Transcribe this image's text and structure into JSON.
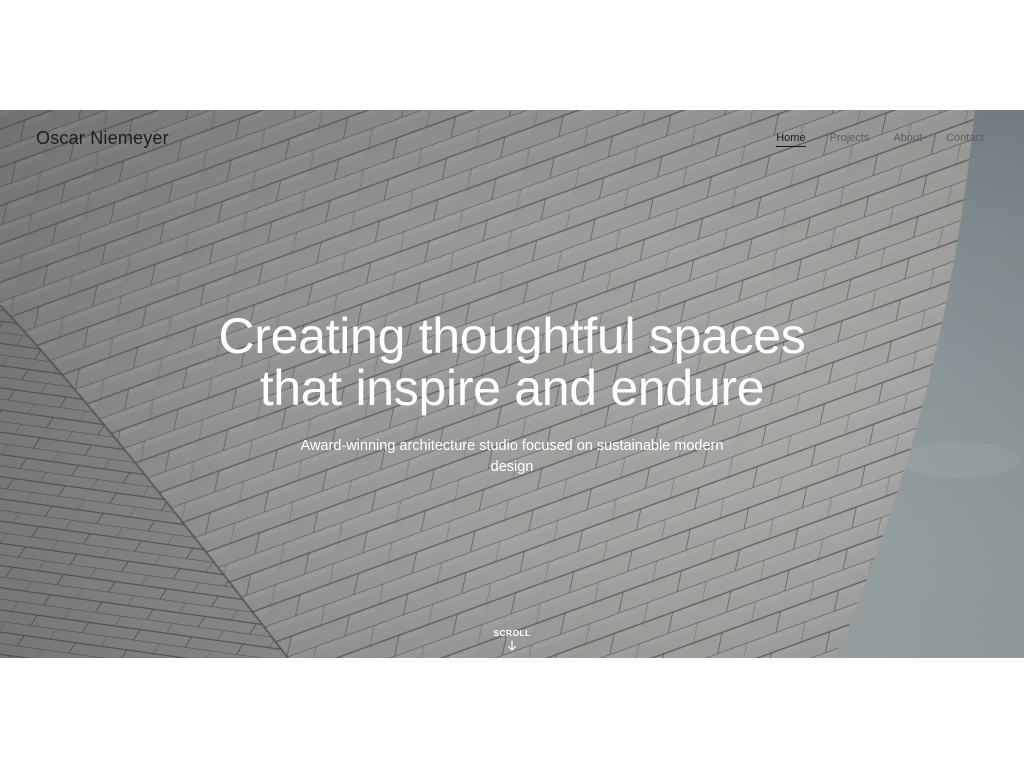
{
  "header": {
    "brand": "Oscar Niemeyer",
    "nav": [
      {
        "label": "Home",
        "active": true
      },
      {
        "label": "Projects",
        "active": false
      },
      {
        "label": "About",
        "active": false
      },
      {
        "label": "Contact",
        "active": false
      }
    ]
  },
  "hero": {
    "headline_line1": "Creating thoughtful spaces",
    "headline_line2": "that inspire and endure",
    "subheadline": "Award-winning architecture studio focused on sustainable modern design",
    "scroll_label": "SCROLL",
    "scroll_icon": "arrow-down-icon",
    "background_image": "tiled-facade-building-against-sky"
  },
  "colors": {
    "text_on_image": "#ffffff",
    "nav_text": "#5d5d5d",
    "nav_active": "#1b1b1b",
    "brand_text": "#1e1e1e",
    "sky": "#9aa6aa",
    "tile_light": "#b8b8b6",
    "tile_dark": "#7a7a78"
  }
}
